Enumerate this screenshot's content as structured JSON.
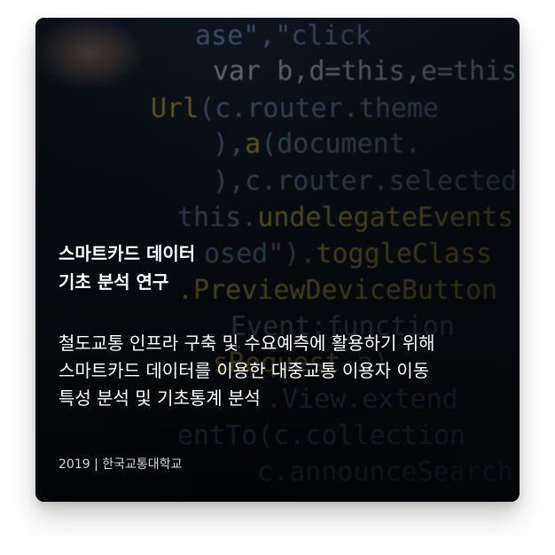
{
  "card": {
    "title_line1": "스마트카드 데이터",
    "title_line2": "기초 분석 연구",
    "description_line1": "철도교통 인프라 구축 및 수요예측에 활용하기 위해",
    "description_line2": "스마트카드 데이터를 이용한 대중교통 이용자 이동",
    "description_line3": "특성 분석 및 기초통계 분석",
    "meta": "2019 | 한국교통대학교"
  }
}
